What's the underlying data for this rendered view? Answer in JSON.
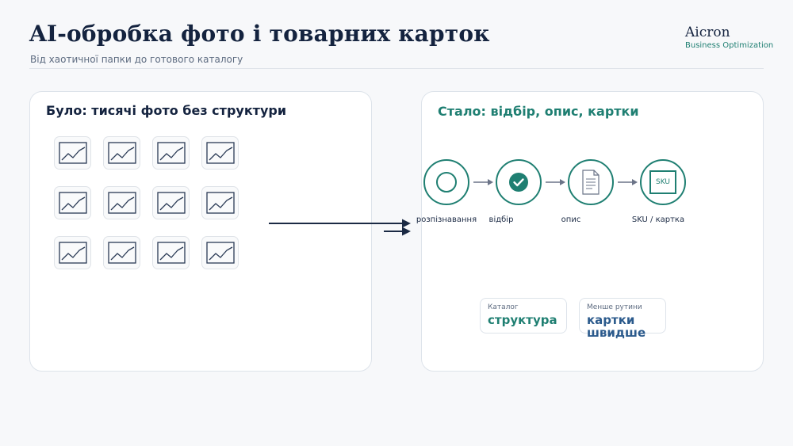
{
  "header": {
    "title": "AI-обробка фото і товарних карток",
    "subtitle": "Від хаотичної папки до готового каталогу"
  },
  "brand": {
    "name": "Aicron",
    "tagline": "Business Optimization"
  },
  "before": {
    "title": "Було: тисячі фото без структури",
    "thumbnail_count": 12,
    "thumbnail_icon": "image-icon"
  },
  "after": {
    "title": "Стало: відбір, опис, картки",
    "steps": [
      {
        "label": "розпізнавання",
        "icon": "circle-icon"
      },
      {
        "label": "відбір",
        "icon": "checkmark-icon"
      },
      {
        "label": "опис",
        "icon": "document-icon"
      },
      {
        "label": "SKU / картка",
        "icon": "sku-box-icon",
        "badge": "SKU"
      }
    ],
    "cards": [
      {
        "label": "Каталог",
        "value": "структура"
      },
      {
        "label": "Менше рутини",
        "value": "картки швидше"
      }
    ]
  },
  "colors": {
    "navy": "#14233f",
    "teal": "#1f7f72",
    "blue": "#2b5a8c",
    "arrow": "#6b7488"
  }
}
